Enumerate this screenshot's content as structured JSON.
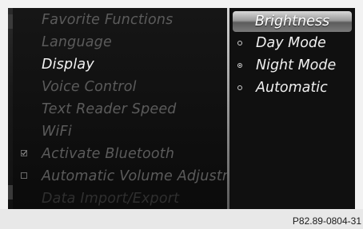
{
  "menu": {
    "items": [
      {
        "label": "Favorite Functions",
        "state": "inactive"
      },
      {
        "label": "Language",
        "state": "inactive"
      },
      {
        "label": "Display",
        "state": "active"
      },
      {
        "label": "Voice Control",
        "state": "inactive"
      },
      {
        "label": "Text Reader Speed",
        "state": "inactive"
      },
      {
        "label": "WiFi",
        "state": "inactive"
      },
      {
        "label": "Activate Bluetooth",
        "state": "inactive",
        "checkbox": "checked"
      },
      {
        "label": "Automatic Volume Adjustment",
        "state": "inactive",
        "checkbox": "unchecked"
      },
      {
        "label": "Data Import/Export",
        "state": "faded"
      }
    ]
  },
  "submenu": {
    "title": "Brightness",
    "options": [
      {
        "label": "Day Mode",
        "selected": false
      },
      {
        "label": "Night Mode",
        "selected": true
      },
      {
        "label": "Automatic",
        "selected": false
      }
    ]
  },
  "caption": "P82.89-0804-31",
  "colors": {
    "screen_bg": "#0d0d0d",
    "active_text": "#f3f3f3",
    "inactive_text": "#5b5b5b",
    "frame": "#f2f2f2",
    "caption_bar": "#e8e8e8"
  },
  "icons": {
    "checkbox_checked": "check-icon",
    "checkbox_unchecked": "empty-square-icon",
    "radio": "radio-icon"
  }
}
